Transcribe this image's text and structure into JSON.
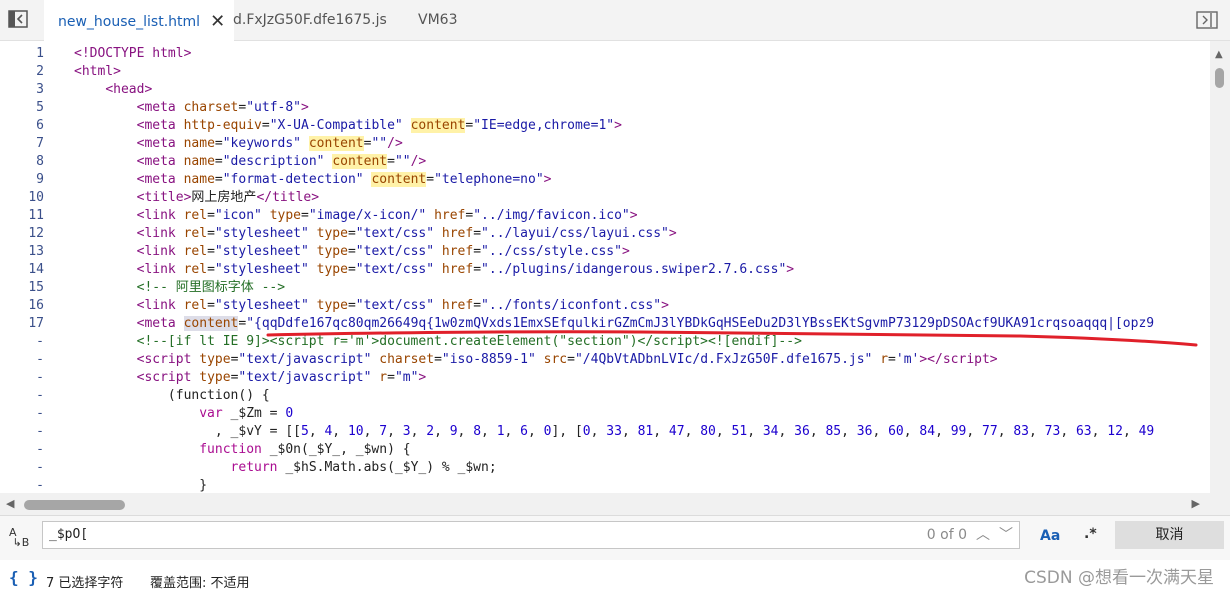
{
  "tabs": [
    {
      "label": "new_house_list.html",
      "active": true
    },
    {
      "label": "d.FxJzG50F.dfe1675.js",
      "active": false
    },
    {
      "label": "VM63",
      "active": false
    }
  ],
  "editor": {
    "lines": [
      {
        "num": "1",
        "html": "<span class=\"tag\">&lt;!DOCTYPE html&gt;</span>"
      },
      {
        "num": "2",
        "html": "<span class=\"tag\">&lt;html&gt;</span>"
      },
      {
        "num": "3",
        "html": "    <span class=\"tag\">&lt;head&gt;</span>"
      },
      {
        "num": "5",
        "html": "        <span class=\"tag\">&lt;meta</span> <span class=\"attr\">charset</span>=<span class=\"val\">\"utf-8\"</span><span class=\"tag\">&gt;</span>"
      },
      {
        "num": "6",
        "html": "        <span class=\"tag\">&lt;meta</span> <span class=\"attr\">http-equiv</span>=<span class=\"val\">\"X-UA-Compatible\"</span> <span class=\"attr hl\">content</span>=<span class=\"val\">\"IE=edge,chrome=1\"</span><span class=\"tag\">&gt;</span>"
      },
      {
        "num": "7",
        "html": "        <span class=\"tag\">&lt;meta</span> <span class=\"attr\">name</span>=<span class=\"val\">\"keywords\"</span> <span class=\"attr hl\">content</span>=<span class=\"val\">\"\"</span><span class=\"tag\">/&gt;</span>"
      },
      {
        "num": "8",
        "html": "        <span class=\"tag\">&lt;meta</span> <span class=\"attr\">name</span>=<span class=\"val\">\"description\"</span> <span class=\"attr hl\">content</span>=<span class=\"val\">\"\"</span><span class=\"tag\">/&gt;</span>"
      },
      {
        "num": "9",
        "html": "        <span class=\"tag\">&lt;meta</span> <span class=\"attr\">name</span>=<span class=\"val\">\"format-detection\"</span> <span class=\"attr hl\">content</span>=<span class=\"val\">\"telephone=no\"</span><span class=\"tag\">&gt;</span>"
      },
      {
        "num": "10",
        "html": "        <span class=\"tag\">&lt;title&gt;</span><span class=\"txt\">网上房地产</span><span class=\"tag\">&lt;/title&gt;</span>"
      },
      {
        "num": "11",
        "html": "        <span class=\"tag\">&lt;link</span> <span class=\"attr\">rel</span>=<span class=\"val\">\"icon\"</span> <span class=\"attr\">type</span>=<span class=\"val\">\"image/x-icon/\"</span> <span class=\"attr\">href</span>=<span class=\"val\">\"../img/favicon.ico\"</span><span class=\"tag\">&gt;</span>"
      },
      {
        "num": "12",
        "html": "        <span class=\"tag\">&lt;link</span> <span class=\"attr\">rel</span>=<span class=\"val\">\"stylesheet\"</span> <span class=\"attr\">type</span>=<span class=\"val\">\"text/css\"</span> <span class=\"attr\">href</span>=<span class=\"val\">\"../layui/css/layui.css\"</span><span class=\"tag\">&gt;</span>"
      },
      {
        "num": "13",
        "html": "        <span class=\"tag\">&lt;link</span> <span class=\"attr\">rel</span>=<span class=\"val\">\"stylesheet\"</span> <span class=\"attr\">type</span>=<span class=\"val\">\"text/css\"</span> <span class=\"attr\">href</span>=<span class=\"val\">\"../css/style.css\"</span><span class=\"tag\">&gt;</span>"
      },
      {
        "num": "14",
        "html": "        <span class=\"tag\">&lt;link</span> <span class=\"attr\">rel</span>=<span class=\"val\">\"stylesheet\"</span> <span class=\"attr\">type</span>=<span class=\"val\">\"text/css\"</span> <span class=\"attr\">href</span>=<span class=\"val\">\"../plugins/idangerous.swiper2.7.6.css\"</span><span class=\"tag\">&gt;</span>"
      },
      {
        "num": "15",
        "html": "        <span class=\"cmt\">&lt;!-- 阿里图标字体 --&gt;</span>"
      },
      {
        "num": "16",
        "html": "        <span class=\"tag\">&lt;link</span> <span class=\"attr\">rel</span>=<span class=\"val\">\"stylesheet\"</span> <span class=\"attr\">type</span>=<span class=\"val\">\"text/css\"</span> <span class=\"attr\">href</span>=<span class=\"val\">\"../fonts/iconfont.css\"</span><span class=\"tag\">&gt;</span>"
      },
      {
        "num": "17",
        "html": "        <span class=\"tag\">&lt;meta</span> <span class=\"attr sel\">content</span>=<span class=\"val\">\"{qqDdfe167qc80qm26649q{1w0zmQVxds1EmxSEfqulkirGZmCmJ3lYBDkGqHSEeDu2D3lYBssEKtSgvmP73129pDSOAcf9UKA91crqsoaqqq|[opz9</span>"
      },
      {
        "num": "-",
        "html": "        <span class=\"cmt\">&lt;!--[if lt IE 9]&gt;&lt;script r='m'&gt;document.createElement(\"section\")&lt;/script&gt;&lt;![endif]--&gt;</span>"
      },
      {
        "num": "-",
        "html": "        <span class=\"tag\">&lt;script</span> <span class=\"attr\">type</span>=<span class=\"val\">\"text/javascript\"</span> <span class=\"attr\">charset</span>=<span class=\"val\">\"iso-8859-1\"</span> <span class=\"attr\">src</span>=<span class=\"val\">\"/4QbVtADbnLVIc/d.FxJzG50F.dfe1675.js\"</span> <span class=\"attr\">r</span>=<span class=\"val\">'m'</span><span class=\"tag\">&gt;&lt;/script&gt;</span>"
      },
      {
        "num": "-",
        "html": "        <span class=\"tag\">&lt;script</span> <span class=\"attr\">type</span>=<span class=\"val\">\"text/javascript\"</span> <span class=\"attr\">r</span>=<span class=\"val\">\"m\"</span><span class=\"tag\">&gt;</span>"
      },
      {
        "num": "-",
        "html": "            <span class=\"txt\">(function() {</span>"
      },
      {
        "num": "-",
        "html": "                <span class=\"kw\">var</span> <span class=\"txt\">_$Zm =</span> <span class=\"num\">0</span>"
      },
      {
        "num": "-",
        "html": "                  <span class=\"txt\">, _$vY = [[</span><span class=\"num\">5</span><span class=\"txt\">,</span> <span class=\"num\">4</span><span class=\"txt\">,</span> <span class=\"num\">10</span><span class=\"txt\">,</span> <span class=\"num\">7</span><span class=\"txt\">,</span> <span class=\"num\">3</span><span class=\"txt\">,</span> <span class=\"num\">2</span><span class=\"txt\">,</span> <span class=\"num\">9</span><span class=\"txt\">,</span> <span class=\"num\">8</span><span class=\"txt\">,</span> <span class=\"num\">1</span><span class=\"txt\">,</span> <span class=\"num\">6</span><span class=\"txt\">,</span> <span class=\"num\">0</span><span class=\"txt\">], [</span><span class=\"num\">0</span><span class=\"txt\">,</span> <span class=\"num\">33</span><span class=\"txt\">,</span> <span class=\"num\">81</span><span class=\"txt\">,</span> <span class=\"num\">47</span><span class=\"txt\">,</span> <span class=\"num\">80</span><span class=\"txt\">,</span> <span class=\"num\">51</span><span class=\"txt\">,</span> <span class=\"num\">34</span><span class=\"txt\">,</span> <span class=\"num\">36</span><span class=\"txt\">,</span> <span class=\"num\">85</span><span class=\"txt\">,</span> <span class=\"num\">36</span><span class=\"txt\">,</span> <span class=\"num\">60</span><span class=\"txt\">,</span> <span class=\"num\">84</span><span class=\"txt\">,</span> <span class=\"num\">99</span><span class=\"txt\">,</span> <span class=\"num\">77</span><span class=\"txt\">,</span> <span class=\"num\">83</span><span class=\"txt\">,</span> <span class=\"num\">73</span><span class=\"txt\">,</span> <span class=\"num\">63</span><span class=\"txt\">,</span> <span class=\"num\">12</span><span class=\"txt\">,</span> <span class=\"num\">49</span>"
      },
      {
        "num": "-",
        "html": "                <span class=\"kw\">function</span> <span class=\"txt\">_$0n(_$Y_, _$wn) {</span>"
      },
      {
        "num": "-",
        "html": "                    <span class=\"kw\">return</span> <span class=\"txt\">_$hS.Math.abs(_$Y_) % _$wn;</span>"
      },
      {
        "num": "-",
        "html": "                <span class=\"txt\">}</span>"
      }
    ]
  },
  "search": {
    "value": "_$pO[",
    "count": "0 of 0",
    "case_label": "Aa",
    "regex_label": ".*",
    "cancel_label": "取消"
  },
  "status": {
    "braces": "{ }",
    "selected": "7 已选择字符",
    "coverage": "覆盖范围: 不适用"
  },
  "watermark": "CSDN @想看一次满天星",
  "colors": {
    "accent": "#1a5fb4",
    "annotation": "#e0202a"
  }
}
